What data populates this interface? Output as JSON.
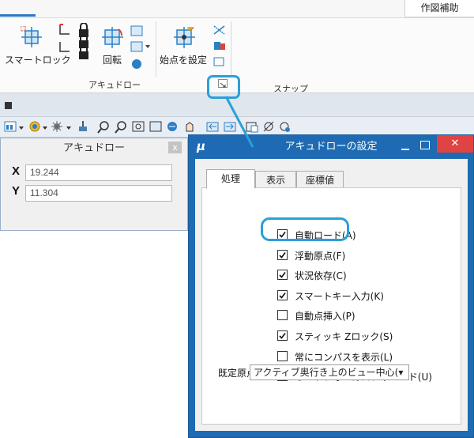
{
  "ribbon": {
    "tab_right": "作図補助",
    "smart_lock_label": "スマートロック",
    "rotate_label": "回転",
    "start_point_label": "始点を設定",
    "group_accudraw": "アキュドロー",
    "group_partial": "スナップ"
  },
  "accudraw_panel": {
    "title": "アキュドロー",
    "close_label": "x",
    "x_label": "X",
    "x_value": "19.244",
    "y_label": "Y",
    "y_value": "11.304"
  },
  "dialog": {
    "title": "アキュドローの設定",
    "app_glyph": "μ",
    "tabs": [
      "処理",
      "表示",
      "座標値"
    ],
    "options": [
      {
        "label": "自動ロード(A)",
        "checked": true
      },
      {
        "label": "浮動原点(F)",
        "checked": true
      },
      {
        "label": "状況依存(C)",
        "checked": true
      },
      {
        "label": "スマートキー入力(K)",
        "checked": true
      },
      {
        "label": "自動点挿入(P)",
        "checked": false
      },
      {
        "label": "スティッキ Zロック(S)",
        "checked": true
      },
      {
        "label": "常にコンパスを表示(L)",
        "checked": false
      },
      {
        "label": "オートフォーカスフィールド(U)",
        "checked": true
      }
    ],
    "default_origin_label": "既定原点:",
    "default_origin_value": "アクティブ奥行き上のビュー中心(▾"
  },
  "colors": {
    "dialog_titlebar": "#1e6bb3",
    "highlight": "#2aa0d8",
    "close_red": "#e04343"
  }
}
